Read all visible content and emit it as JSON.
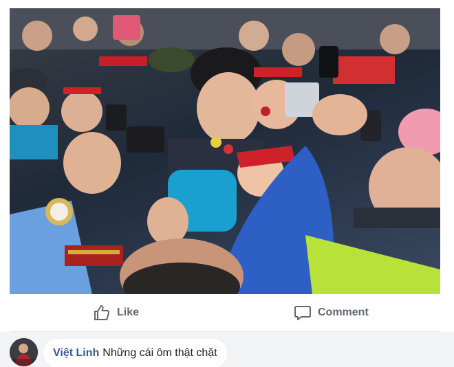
{
  "post": {
    "photo_icon": "crowd-photo",
    "actions": {
      "like_label": "Like",
      "like_icon": "thumbs-up-icon",
      "comment_label": "Comment",
      "comment_icon": "speech-bubble-icon"
    },
    "comment": {
      "author": "Việt Linh",
      "text": "Những cái ôm thật chặt",
      "avatar_icon": "user-avatar"
    }
  },
  "colors": {
    "action_text": "#606770",
    "author_name": "#385898",
    "comment_bg": "#f2f3f5"
  }
}
